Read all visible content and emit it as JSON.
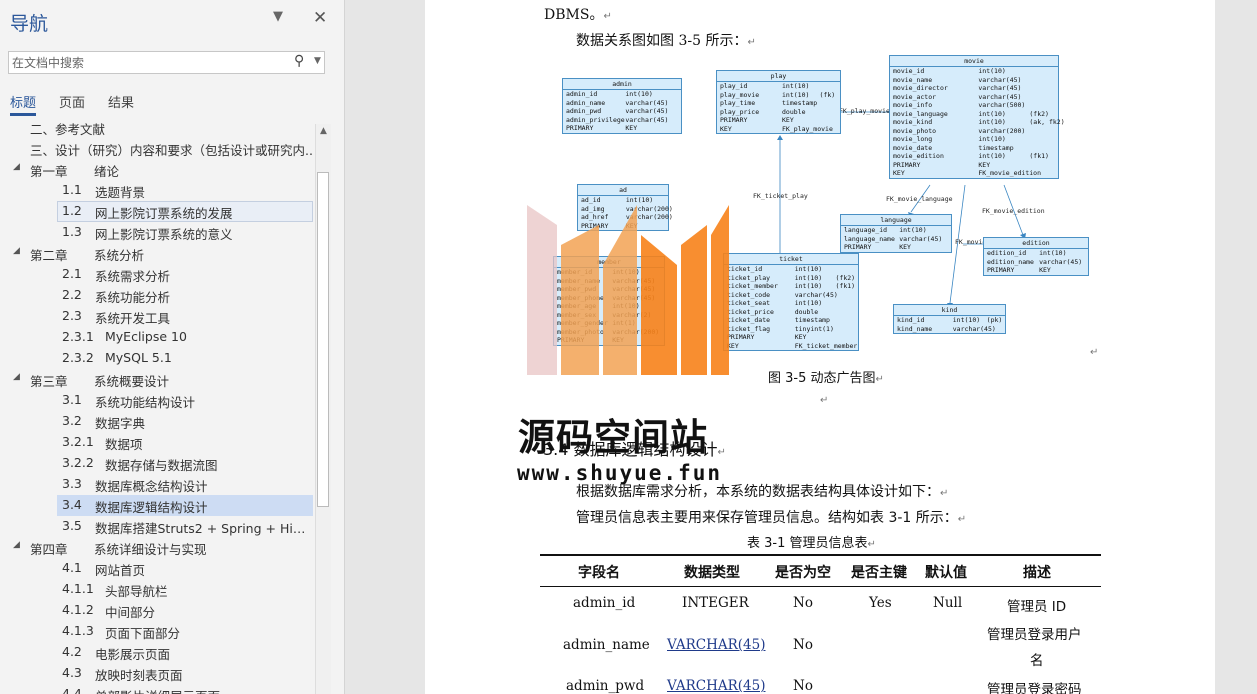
{
  "nav": {
    "title": "导航",
    "search_placeholder": "在文档中搜索",
    "tabs": [
      "标题",
      "页面",
      "结果"
    ],
    "items": [
      {
        "num": "二、参考文献",
        "label": ""
      },
      {
        "num": "三、设计（研究）内容和要求（包括设计或研究内...",
        "label": ""
      },
      {
        "num": "第一章",
        "label": "绪论"
      },
      {
        "num": "1.1",
        "label": "选题背景"
      },
      {
        "num": "1.2",
        "label": "网上影院订票系统的发展"
      },
      {
        "num": "1.3",
        "label": "网上影院订票系统的意义"
      },
      {
        "num": "第二章",
        "label": "系统分析"
      },
      {
        "num": "2.1",
        "label": "系统需求分析"
      },
      {
        "num": "2.2",
        "label": "系统功能分析"
      },
      {
        "num": "2.3",
        "label": "系统开发工具"
      },
      {
        "num": "2.3.1",
        "label": "MyEclipse 10"
      },
      {
        "num": "2.3.2",
        "label": "MySQL 5.1"
      },
      {
        "num": "第三章",
        "label": "系统概要设计"
      },
      {
        "num": "3.1",
        "label": "系统功能结构设计"
      },
      {
        "num": "3.2",
        "label": "数据字典"
      },
      {
        "num": "3.2.1",
        "label": "数据项"
      },
      {
        "num": "3.2.2",
        "label": "数据存储与数据流图"
      },
      {
        "num": "3.3",
        "label": "数据库概念结构设计"
      },
      {
        "num": "3.4",
        "label": "数据库逻辑结构设计"
      },
      {
        "num": "3.5",
        "label": "数据库搭建Struts2 + Spring + Hiber..."
      },
      {
        "num": "第四章",
        "label": "系统详细设计与实现"
      },
      {
        "num": "4.1",
        "label": "网站首页"
      },
      {
        "num": "4.1.1",
        "label": "头部导航栏"
      },
      {
        "num": "4.1.2",
        "label": "中间部分"
      },
      {
        "num": "4.1.3",
        "label": "页面下面部分"
      },
      {
        "num": "4.2",
        "label": "电影展示页面"
      },
      {
        "num": "4.3",
        "label": "放映时刻表页面"
      },
      {
        "num": "4.4",
        "label": "单部影片详细展示页面"
      }
    ]
  },
  "doc": {
    "line_dbms": "DBMS。",
    "line_intro": "数据关系图如图 3-5 所示：",
    "figure_caption": "图 3-5      动态广告图",
    "section_heading": "3.4    数据库逻辑结构设计",
    "para1": "根据数据库需求分析，本系统的数据表结构具体设计如下：",
    "para2": "管理员信息表主要用来保存管理员信息。结构如表 3-1 所示：",
    "table_caption": "表 3-1      管理员信息表",
    "pilcrow": "↵"
  },
  "table": {
    "headers": [
      "字段名",
      "数据类型",
      "是否为空",
      "是否主键",
      "默认值",
      "描述"
    ],
    "rows": [
      [
        "admin_id",
        "INTEGER",
        "No",
        "Yes",
        "Null",
        "管理员 ID"
      ],
      [
        "admin_name",
        "VARCHAR(45)",
        "No",
        "",
        "",
        "管理员登录用户名"
      ],
      [
        "admin_pwd",
        "VARCHAR(45)",
        "No",
        "",
        "",
        "管理员登录密码"
      ]
    ],
    "row2_desc_line1": "管理员登录用户",
    "row2_desc_line2": "名"
  },
  "er": {
    "admin": {
      "title": "admin",
      "rows": [
        [
          "admin_id",
          "int(10)",
          ""
        ],
        [
          "admin_name",
          "varchar(45)",
          ""
        ],
        [
          "admin_pwd",
          "varchar(45)",
          ""
        ],
        [
          "admin_privilege",
          "varchar(45)",
          ""
        ],
        [
          "PRIMARY",
          "KEY",
          ""
        ]
      ]
    },
    "play": {
      "title": "play",
      "rows": [
        [
          "play_id",
          "int(10)",
          ""
        ],
        [
          "play_movie",
          "int(10)",
          "(fk)"
        ],
        [
          "play_time",
          "timestamp",
          ""
        ],
        [
          "play_price",
          "double",
          ""
        ],
        [
          "PRIMARY",
          "KEY",
          ""
        ],
        [
          "KEY",
          "FK_play_movie",
          ""
        ]
      ]
    },
    "movie": {
      "title": "movie",
      "rows": [
        [
          "movie_id",
          "int(10)",
          ""
        ],
        [
          "movie_name",
          "varchar(45)",
          ""
        ],
        [
          "movie_director",
          "varchar(45)",
          ""
        ],
        [
          "movie_actor",
          "varchar(45)",
          ""
        ],
        [
          "movie_info",
          "varchar(500)",
          ""
        ],
        [
          "movie_language",
          "int(10)",
          "(fk2)"
        ],
        [
          "movie_kind",
          "int(10)",
          "(ak, fk2)"
        ],
        [
          "movie_photo",
          "varchar(200)",
          ""
        ],
        [
          "movie_long",
          "int(10)",
          ""
        ],
        [
          "movie_date",
          "timestamp",
          ""
        ],
        [
          "movie_edition",
          "int(10)",
          "(fk1)"
        ],
        [
          "PRIMARY",
          "KEY",
          ""
        ],
        [
          "KEY",
          "FK_movie_edition",
          ""
        ]
      ]
    },
    "ad": {
      "title": "ad",
      "rows": [
        [
          "ad_id",
          "int(10)",
          ""
        ],
        [
          "ad_img",
          "varchar(200)",
          ""
        ],
        [
          "ad_href",
          "varchar(200)",
          ""
        ],
        [
          "PRIMARY",
          "KEY",
          ""
        ]
      ]
    },
    "language": {
      "title": "language",
      "rows": [
        [
          "language_id",
          "int(10)",
          ""
        ],
        [
          "language_name",
          "varchar(45)",
          ""
        ],
        [
          "PRIMARY",
          "KEY",
          ""
        ]
      ]
    },
    "edition": {
      "title": "edition",
      "rows": [
        [
          "edition_id",
          "int(10)",
          ""
        ],
        [
          "edition_name",
          "varchar(45)",
          ""
        ],
        [
          "PRIMARY",
          "KEY",
          ""
        ]
      ]
    },
    "member": {
      "title": "member",
      "rows": [
        [
          "member_id",
          "int(10)",
          ""
        ],
        [
          "member_name",
          "varchar(45)",
          ""
        ],
        [
          "member_pwd",
          "varchar(45)",
          ""
        ],
        [
          "member_phone",
          "varchar(45)",
          ""
        ],
        [
          "member_age",
          "int(10)",
          ""
        ],
        [
          "member_sex",
          "varchar(2)",
          ""
        ],
        [
          "member_gender",
          "int(1)",
          ""
        ],
        [
          "member_photo",
          "varchar(200)",
          ""
        ],
        [
          "PRIMARY",
          "KEY",
          ""
        ]
      ]
    },
    "ticket": {
      "title": "ticket",
      "rows": [
        [
          "ticket_id",
          "int(10)",
          ""
        ],
        [
          "ticket_play",
          "int(10)",
          "(fk2)"
        ],
        [
          "ticket_member",
          "int(10)",
          "(fk1)"
        ],
        [
          "ticket_code",
          "varchar(45)",
          ""
        ],
        [
          "ticket_seat",
          "int(10)",
          ""
        ],
        [
          "ticket_price",
          "double",
          ""
        ],
        [
          "ticket_date",
          "timestamp",
          ""
        ],
        [
          "ticket_flag",
          "tinyint(1)",
          ""
        ],
        [
          "PRIMARY",
          "KEY",
          ""
        ],
        [
          "KEY",
          "FK_ticket_member",
          ""
        ]
      ]
    },
    "kind": {
      "title": "kind",
      "rows": [
        [
          "kind_id",
          "int(10)",
          "(pk)"
        ],
        [
          "kind_name",
          "varchar(45)",
          ""
        ]
      ]
    },
    "fk_labels": [
      "FK_play_movie",
      "FK_ticket_play",
      "FK_movie_language",
      "FK_movie_edition",
      "FK_movie_kind"
    ]
  },
  "watermark": {
    "title": "源码空间站",
    "url": "www.shuyue.fun",
    "colors": [
      "#f2a254",
      "#f7821a",
      "#e8c4c4"
    ]
  }
}
